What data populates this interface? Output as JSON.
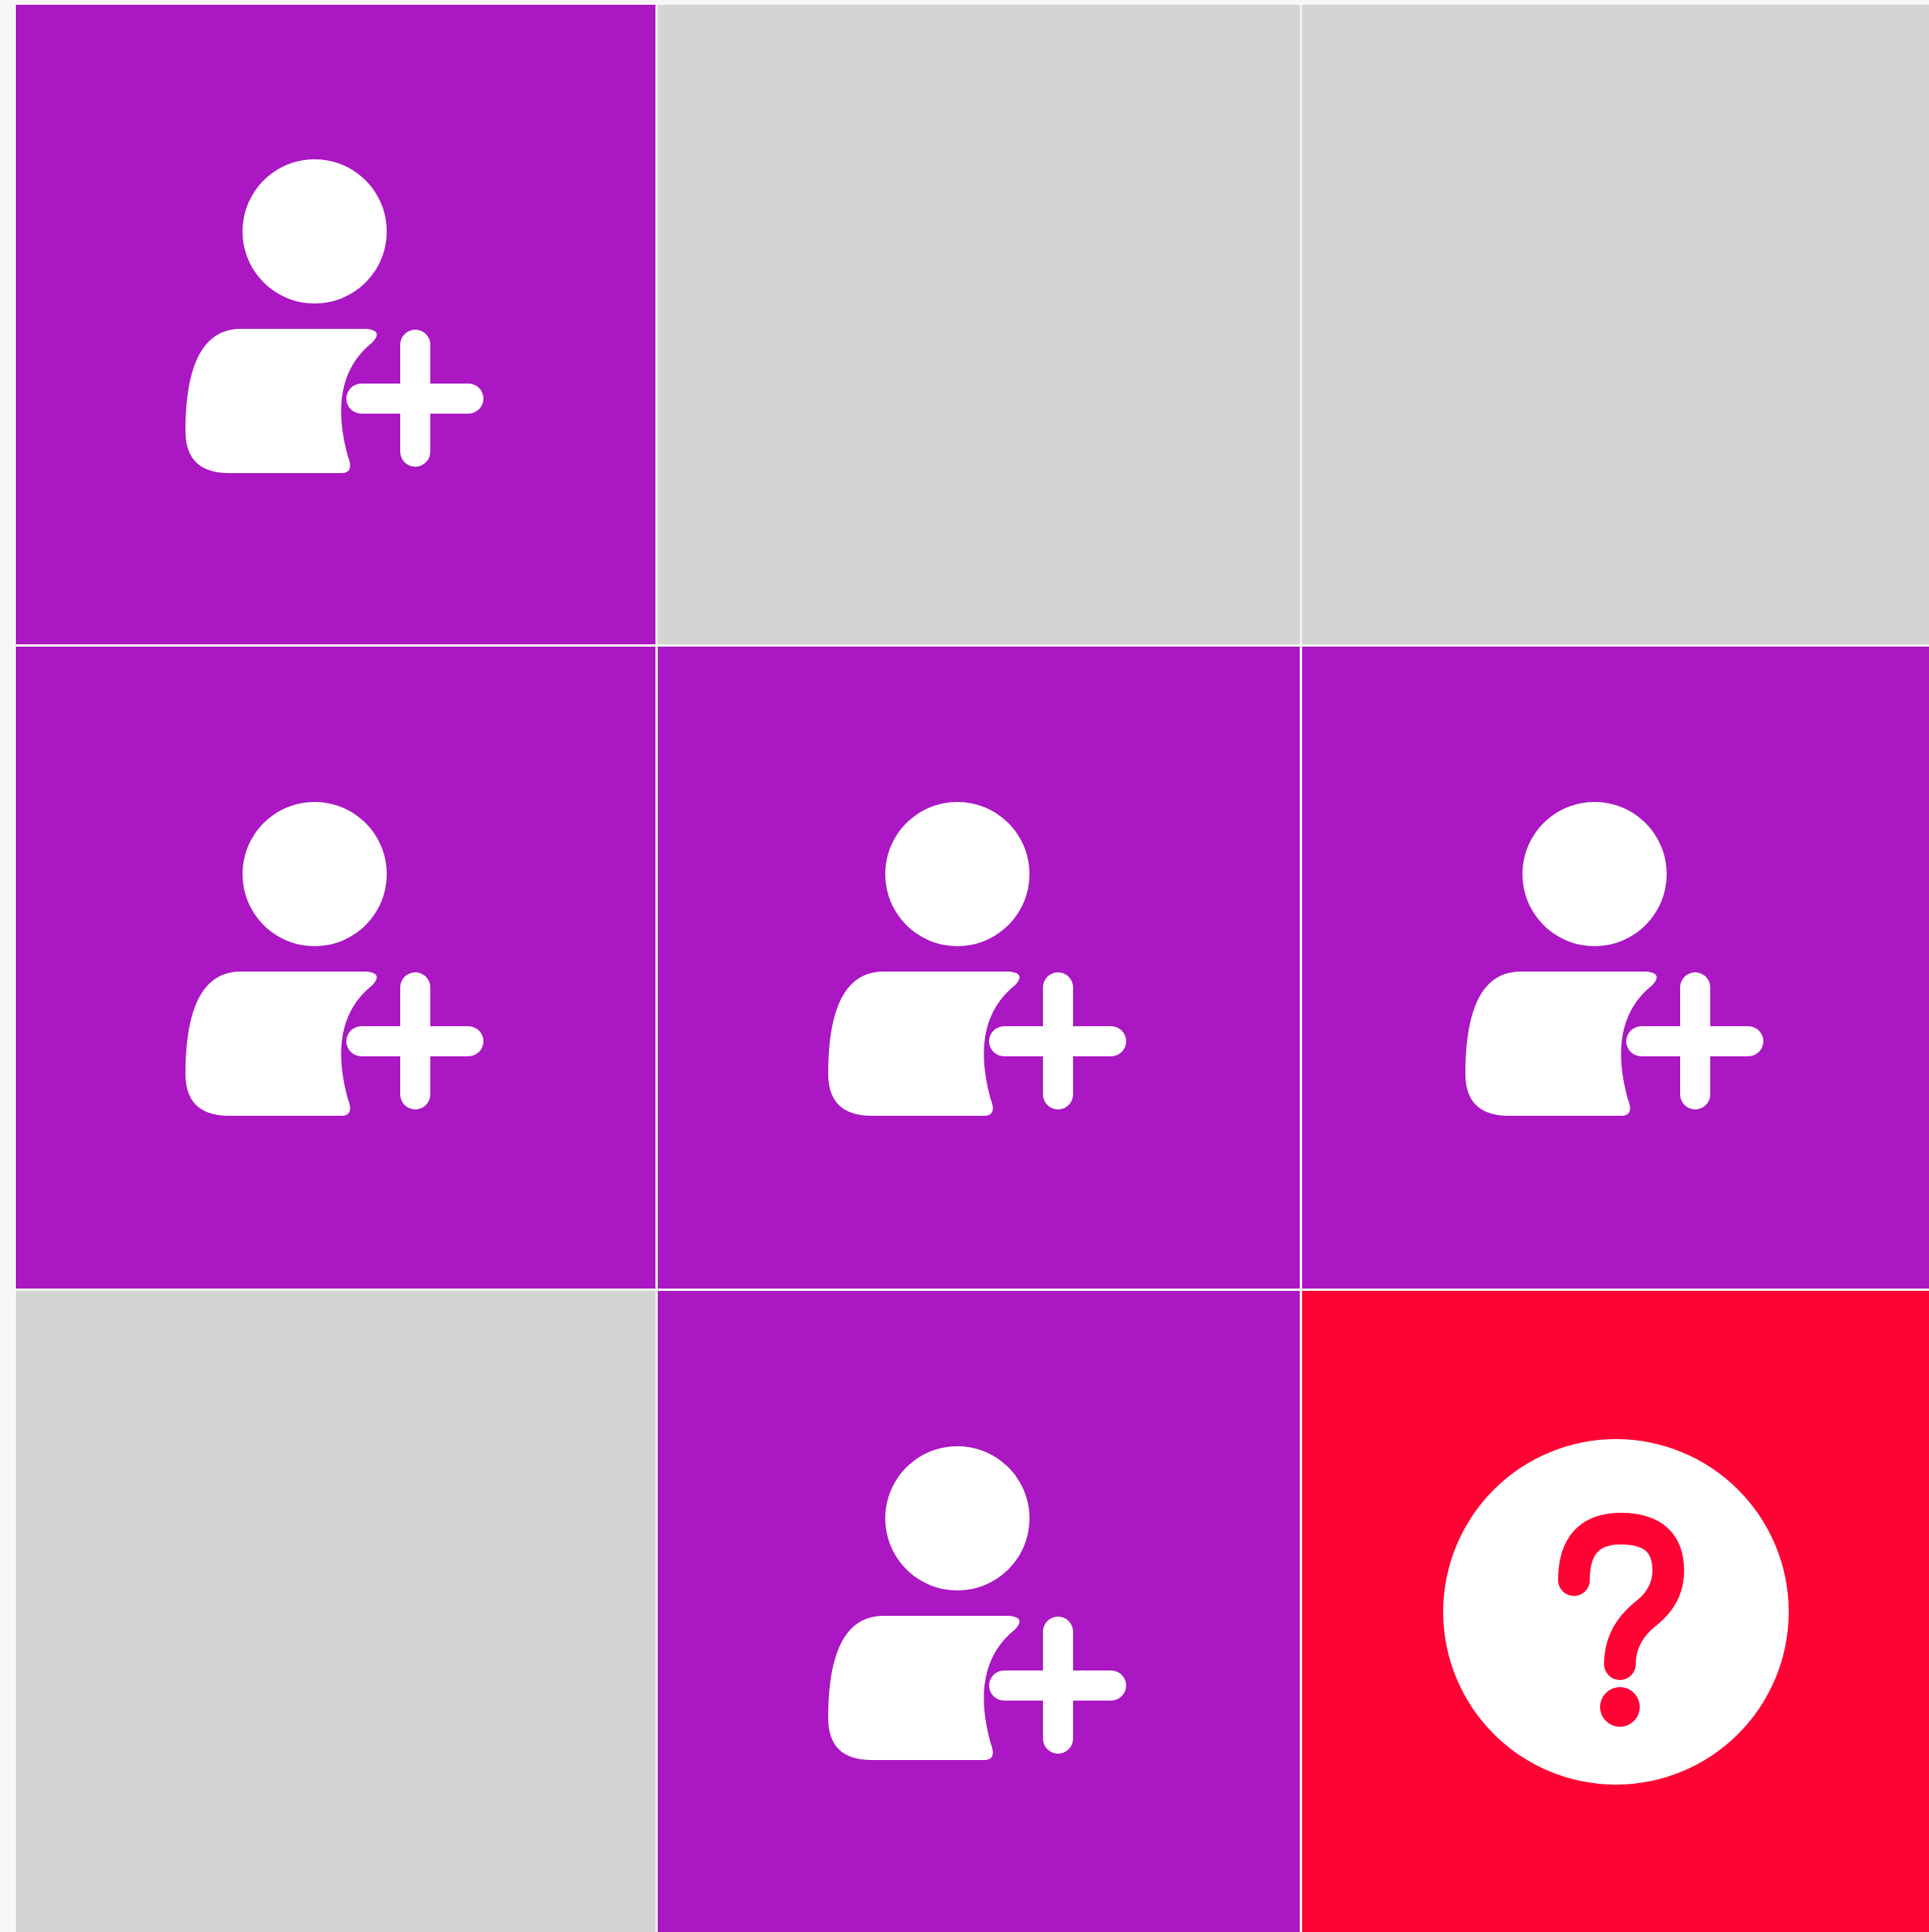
{
  "colors": {
    "purple": "#aa17c3",
    "gray": "#d4d4d4",
    "red": "#ff0335",
    "white": "#ffffff"
  },
  "tiles": [
    {
      "state": "purple",
      "icon": "user-plus-icon"
    },
    {
      "state": "gray",
      "icon": ""
    },
    {
      "state": "gray",
      "icon": ""
    },
    {
      "state": "purple",
      "icon": "user-plus-icon"
    },
    {
      "state": "purple",
      "icon": "user-plus-icon"
    },
    {
      "state": "purple",
      "icon": "user-plus-icon"
    },
    {
      "state": "gray",
      "icon": ""
    },
    {
      "state": "purple",
      "icon": "user-plus-icon"
    },
    {
      "state": "red",
      "icon": "question-circle-icon"
    }
  ]
}
